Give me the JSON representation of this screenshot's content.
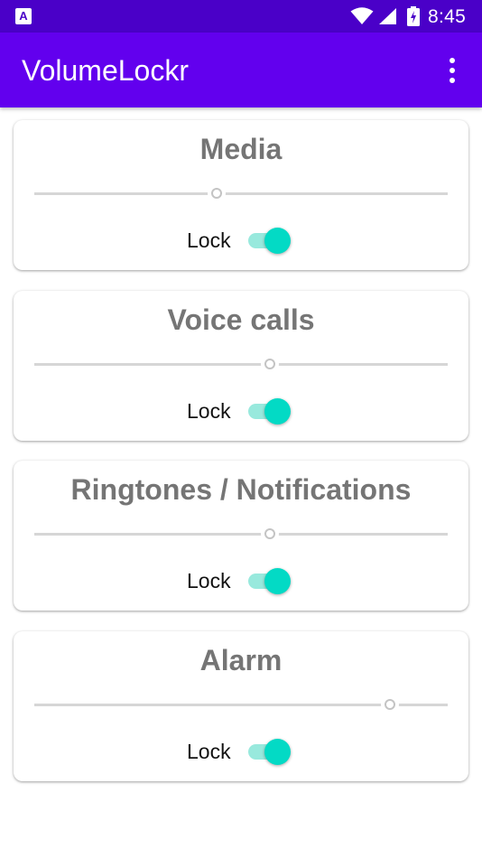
{
  "status_bar": {
    "app_icon": "a-letter-icon",
    "app_icon_letter": "A",
    "wifi": "wifi-icon",
    "signal": "signal-icon",
    "battery": "battery-charging-icon",
    "time": "8:45",
    "background_color": "#4a00c8"
  },
  "app_bar": {
    "title": "VolumeLockr",
    "menu_icon": "more-vert-icon",
    "background_color": "#6200ee"
  },
  "accent_color": "#03dac5",
  "streams": [
    {
      "title": "Media",
      "volume": 0.44,
      "lock_label": "Lock",
      "locked": true
    },
    {
      "title": "Voice calls",
      "volume": 0.57,
      "lock_label": "Lock",
      "locked": true
    },
    {
      "title": "Ringtones / Notifications",
      "volume": 0.57,
      "lock_label": "Lock",
      "locked": true
    },
    {
      "title": "Alarm",
      "volume": 0.86,
      "lock_label": "Lock",
      "locked": true
    }
  ]
}
